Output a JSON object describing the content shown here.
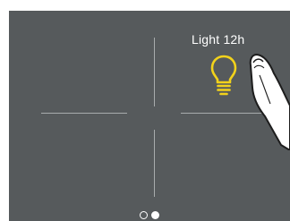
{
  "tile_top_right": {
    "label": "Light 12h",
    "icon": "lightbulb-icon",
    "icon_color": "#f2d21b"
  },
  "colors": {
    "panel_background": "#565a5c",
    "divider": "#a8acad",
    "text": "#ffffff"
  },
  "pager": {
    "page_count": 2,
    "active_page": 2
  },
  "overlay": {
    "icon": "pointing-finger-icon"
  }
}
